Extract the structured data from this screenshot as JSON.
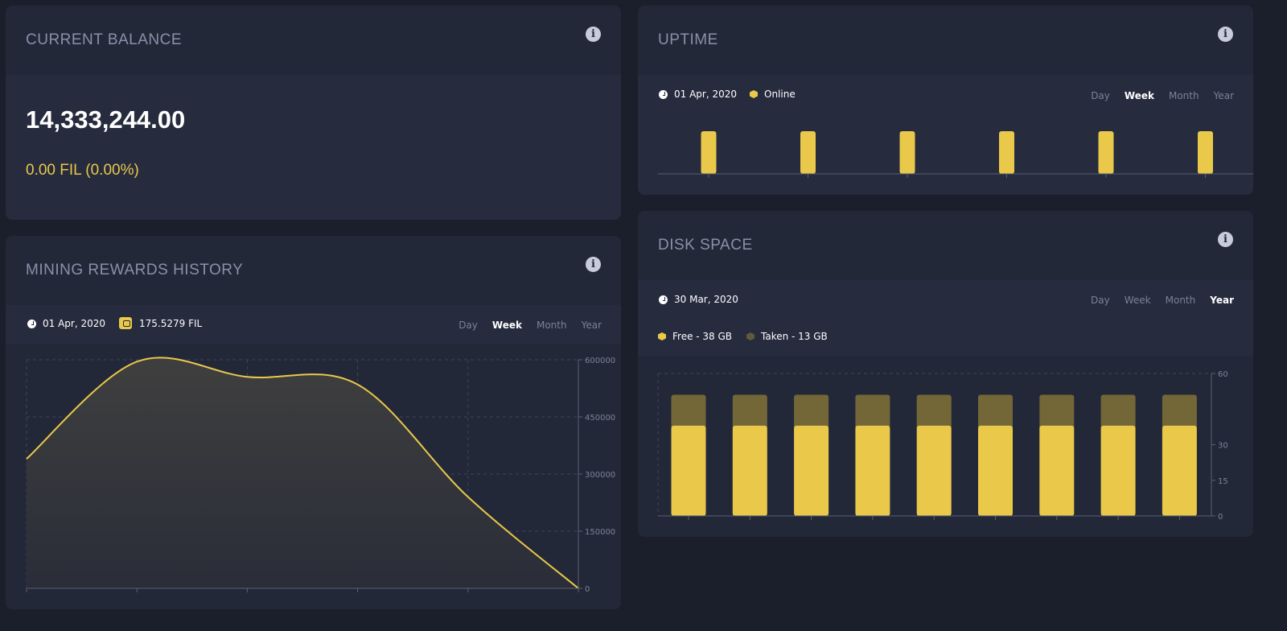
{
  "balance": {
    "title": "CURRENT BALANCE",
    "amount": "14,333,244.00",
    "change": "0.00 FIL (0.00%)"
  },
  "rewards": {
    "title": "MINING REWARDS HISTORY",
    "date": "01 Apr, 2020",
    "total": "175.5279 FIL",
    "periods": [
      "Day",
      "Week",
      "Month",
      "Year"
    ],
    "active_period": "Week"
  },
  "uptime": {
    "title": "UPTIME",
    "date": "01 Apr, 2020",
    "legend": "Online",
    "periods": [
      "Day",
      "Week",
      "Month",
      "Year"
    ],
    "active_period": "Week"
  },
  "disk": {
    "title": "DISK SPACE",
    "date": "30 Mar, 2020",
    "legend_free": "Free - 38 GB",
    "legend_taken": "Taken - 13 GB",
    "periods": [
      "Day",
      "Week",
      "Month",
      "Year"
    ],
    "active_period": "Year"
  },
  "colors": {
    "accent": "#e9c84a",
    "taken": "#736637",
    "bg": "#1b1f2c",
    "card": "#232839"
  },
  "chart_data": [
    {
      "type": "area",
      "x": [
        0,
        1,
        2,
        3,
        4,
        5
      ],
      "values": [
        340000,
        595000,
        555000,
        535000,
        240000,
        0
      ],
      "yticks": [
        0,
        150000,
        300000,
        450000,
        600000
      ],
      "ylim": [
        0,
        600000
      ],
      "grid": true
    },
    {
      "type": "bar",
      "categories": [
        "1",
        "2",
        "3",
        "4",
        "5",
        "6"
      ],
      "series": [
        {
          "name": "Online",
          "values": [
            1,
            1,
            1,
            1,
            1,
            1
          ]
        }
      ]
    },
    {
      "type": "bar",
      "stacked": true,
      "categories": [
        "1",
        "2",
        "3",
        "4",
        "5",
        "6",
        "7",
        "8",
        "9"
      ],
      "series": [
        {
          "name": "Free - 38 GB",
          "values": [
            38,
            38,
            38,
            38,
            38,
            38,
            38,
            38,
            38
          ]
        },
        {
          "name": "Taken - 13 GB",
          "values": [
            13,
            13,
            13,
            13,
            13,
            13,
            13,
            13,
            13
          ]
        }
      ],
      "yticks": [
        0,
        15,
        30,
        60
      ],
      "ylim": [
        0,
        60
      ]
    }
  ]
}
